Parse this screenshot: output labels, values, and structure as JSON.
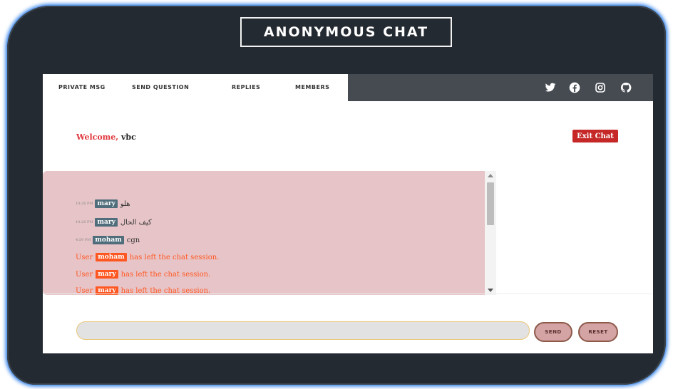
{
  "app_title": "ANONYMOUS CHAT",
  "nav": {
    "tabs": [
      {
        "label": "PRIVATE MSG"
      },
      {
        "label": "SEND QUESTION"
      },
      {
        "label": "REPLIES"
      },
      {
        "label": "MEMBERS"
      }
    ],
    "social_icons": [
      "twitter-icon",
      "facebook-icon",
      "instagram-icon",
      "github-icon"
    ]
  },
  "welcome": {
    "prefix": "Welcome,",
    "username": "vbc"
  },
  "exit_button": "Exit Chat",
  "messages": [
    {
      "time": "10:26 PM",
      "user": "mary",
      "text": "هلو"
    },
    {
      "time": "10:26 PM",
      "user": "mary",
      "text": "كيف الحال"
    },
    {
      "time": "4:59 PM",
      "user": "moham",
      "text": "cgn"
    }
  ],
  "system_messages": [
    {
      "prefix": "User",
      "user": "moham",
      "suffix": "has left the chat session."
    },
    {
      "prefix": "User",
      "user": "mary",
      "suffix": "has left the chat session."
    },
    {
      "prefix": "User",
      "user": "mary",
      "suffix": "has left the chat session."
    }
  ],
  "input": {
    "value": "",
    "placeholder": ""
  },
  "buttons": {
    "send": "SEND",
    "reset": "RESET"
  },
  "colors": {
    "frame": "#242a31",
    "nav_dark": "#464b52",
    "chat_bg": "#e7c4c7",
    "badge": "#4f6d7a",
    "system": "#ff5722",
    "exit": "#c62828",
    "welcome": "#e0383e"
  }
}
